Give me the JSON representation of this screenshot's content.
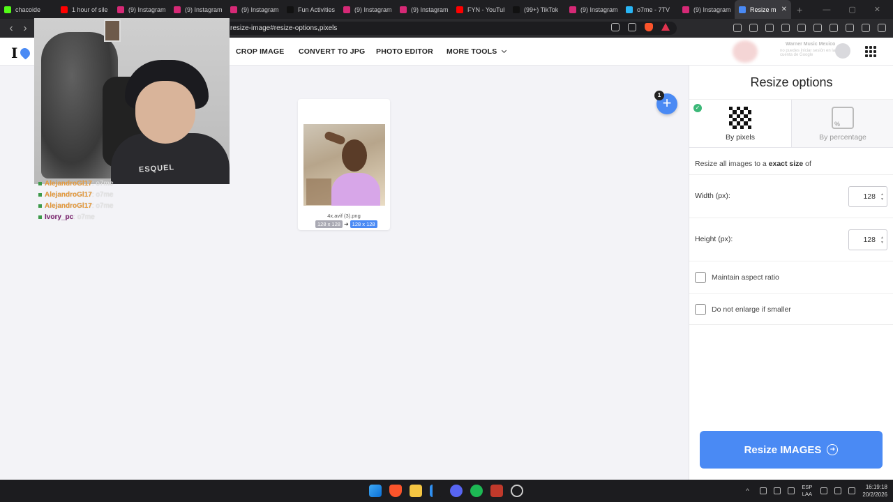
{
  "browser": {
    "tabs": [
      {
        "title": "chacoide",
        "fav": "kick",
        "color": "#53fc18"
      },
      {
        "title": "1 hour of sile",
        "fav": "youtube",
        "color": "#ff0000"
      },
      {
        "title": "(9) Instagram",
        "fav": "instagram",
        "color": "#d62976"
      },
      {
        "title": "(9) Instagram",
        "fav": "instagram",
        "color": "#d62976"
      },
      {
        "title": "(9) Instagram",
        "fav": "instagram",
        "color": "#d62976"
      },
      {
        "title": "Fun Activities",
        "fav": "tiktok",
        "color": "#111111"
      },
      {
        "title": "(9) Instagram",
        "fav": "instagram",
        "color": "#d62976"
      },
      {
        "title": "(9) Instagram",
        "fav": "instagram",
        "color": "#d62976"
      },
      {
        "title": "FYN - YouTub",
        "fav": "youtube",
        "color": "#ff0000"
      },
      {
        "title": "(99+) TikTok",
        "fav": "tiktok",
        "color": "#111111"
      },
      {
        "title": "(9) Instagram",
        "fav": "instagram",
        "color": "#d62976"
      },
      {
        "title": "o7me - 7TV",
        "fav": "7tv",
        "color": "#29b6f6"
      },
      {
        "title": "(9) Instagram",
        "fav": "instagram",
        "color": "#d62976"
      },
      {
        "title": "Resize m",
        "fav": "ilovepdf",
        "color": "#4a8af4",
        "active": true
      }
    ],
    "url": "resize-image#resize-options,pixels"
  },
  "header": {
    "logo_text": "I",
    "nav": {
      "crop": "CROP IMAGE",
      "convert": "CONVERT TO JPG",
      "editor": "PHOTO EDITOR",
      "more": "MORE TOOLS"
    },
    "ad": {
      "line1": "Warner Music Mexico",
      "line2": "no puedes iniciar sesión en la cuenta de Google"
    }
  },
  "stream": {
    "shirt_text": "ESQUEL",
    "chat": [
      {
        "user": "AlejandroGl17",
        "msg": ": o7me",
        "color": "orange"
      },
      {
        "user": "AlejandroGl17",
        "msg": ": o7me",
        "color": "orange"
      },
      {
        "user": "AlejandroGl17",
        "msg": ": o7me",
        "color": "orange"
      },
      {
        "user": "Ivory_pc",
        "msg": ": o7me",
        "color": "purple"
      }
    ]
  },
  "file": {
    "name": "4x.avif (3).png",
    "original_dims": "128 x 128",
    "new_dims": "128 x 128"
  },
  "add_badge": "1",
  "panel": {
    "title": "Resize options",
    "tab_pixels": "By pixels",
    "tab_percentage": "By percentage",
    "desc_prefix": "Resize all images to a ",
    "desc_bold": "exact size",
    "desc_suffix": " of",
    "width_label": "Width (px):",
    "width_value": "128",
    "height_label": "Height (px):",
    "height_value": "128",
    "aspect_label": "Maintain aspect ratio",
    "aspect_checked": false,
    "enlarge_label": "Do not enlarge if smaller",
    "enlarge_checked": false,
    "button": "Resize IMAGES"
  },
  "taskbar": {
    "lang1": "ESP",
    "lang2": "LAA",
    "time": "16:19:18",
    "date": "20/2/2026"
  }
}
